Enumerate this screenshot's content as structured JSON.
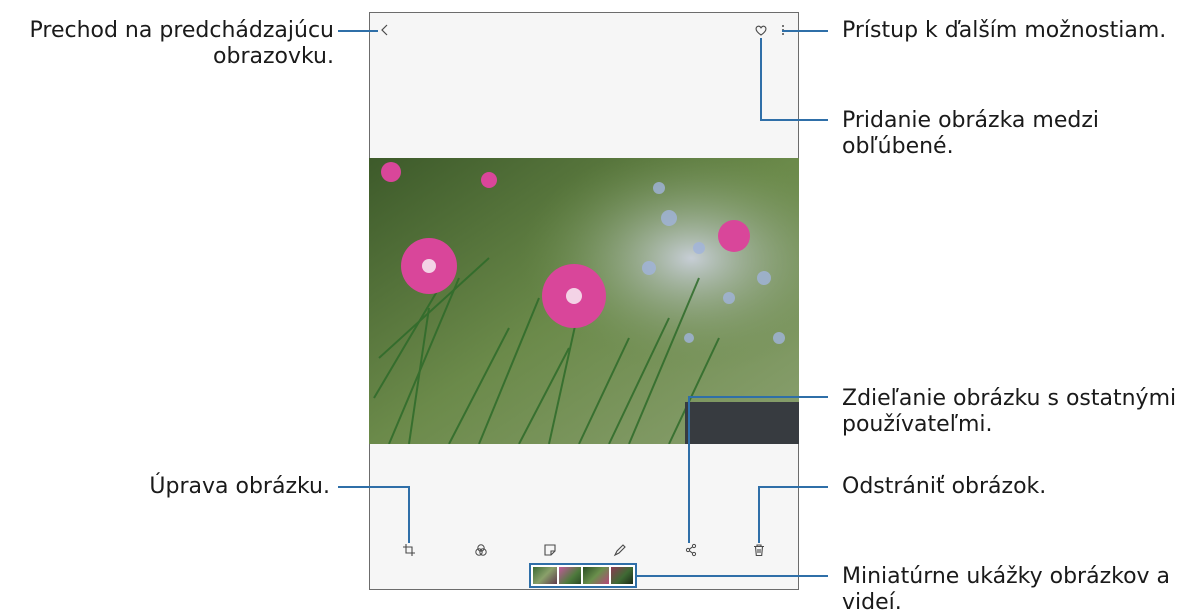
{
  "callouts": {
    "back": "Prechod na predchádzajúcu obrazovku.",
    "more": "Prístup k ďalším možnostiam.",
    "favorite": "Pridanie obrázka medzi obľúbené.",
    "share": "Zdieľanie obrázku s ostatnými používateľmi.",
    "edit": "Úprava obrázku.",
    "delete": "Odstrániť obrázok.",
    "thumbnails": "Miniatúrne ukážky obrázkov a videí."
  },
  "icons": {
    "back": "back-arrow-icon",
    "favorite": "heart-icon",
    "more": "more-options-icon",
    "edit": "crop-icon",
    "filter": "filter-icon",
    "sticker": "sticker-icon",
    "draw": "draw-icon",
    "share": "share-icon",
    "delete": "trash-icon"
  },
  "colors": {
    "leader_line": "#2f6fa8",
    "thumbnail_border": "#2f6fa8",
    "flower": "#d9469a"
  }
}
